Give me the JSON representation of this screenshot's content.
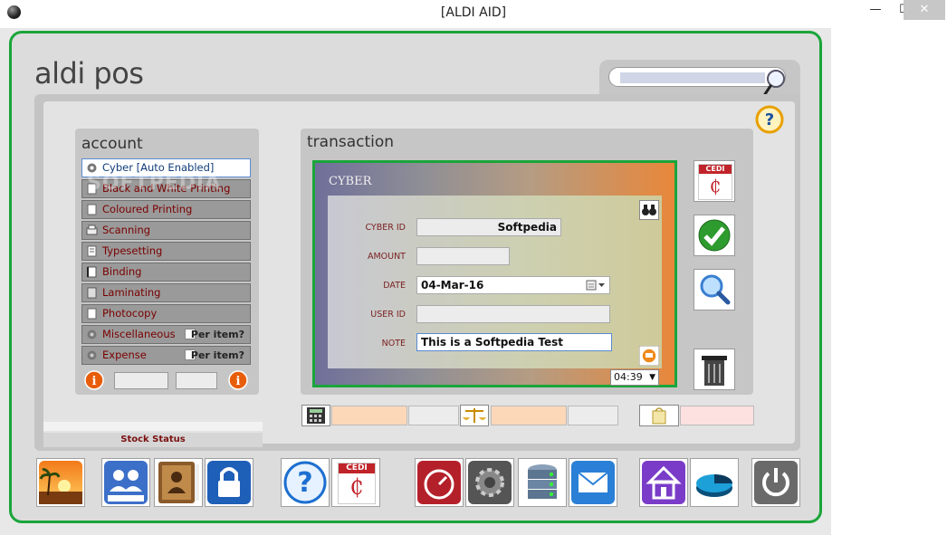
{
  "window": {
    "title": "[ALDI AID]",
    "min_glyph": "—",
    "max_glyph": "☐",
    "close_glyph": "✕"
  },
  "app": {
    "logo": "aldi pos"
  },
  "account": {
    "heading": "account",
    "items": [
      {
        "label": "Cyber  [Auto Enabled]",
        "icon": "gear-icon"
      },
      {
        "label": "Black and White Printing",
        "icon": "document-icon"
      },
      {
        "label": "Coloured Printing",
        "icon": "document-icon"
      },
      {
        "label": "Scanning",
        "icon": "scanner-icon"
      },
      {
        "label": "Typesetting",
        "icon": "document-icon"
      },
      {
        "label": "Binding",
        "icon": "binding-icon"
      },
      {
        "label": "Laminating",
        "icon": "laminate-icon"
      },
      {
        "label": "Photocopy",
        "icon": "document-icon"
      },
      {
        "label": "Miscellaneous",
        "icon": "gear-icon",
        "per_item": "Per item?"
      },
      {
        "label": "Expense",
        "icon": "gear-icon",
        "per_item": "Per item?"
      }
    ]
  },
  "watermark": "SOFTPEDIA",
  "transaction": {
    "heading": "transaction",
    "card_title": "CYBER",
    "fields": {
      "cyber_id": {
        "label": "CYBER ID",
        "value": "Softpedia"
      },
      "amount": {
        "label": "AMOUNT",
        "value": ""
      },
      "date": {
        "label": "DATE",
        "value": "04-Mar-16"
      },
      "user_id": {
        "label": "USER ID",
        "value": ""
      },
      "note": {
        "label": "NOTE",
        "value": "This is a Softpedia Test"
      }
    },
    "time": "04:39"
  },
  "side_buttons": {
    "cedi_label": "CEDI",
    "cedi_symbol": "₵"
  },
  "bottom": {
    "stock_status": "Stock Status",
    "cedi_label": "CEDI",
    "cedi_symbol": "₵"
  }
}
